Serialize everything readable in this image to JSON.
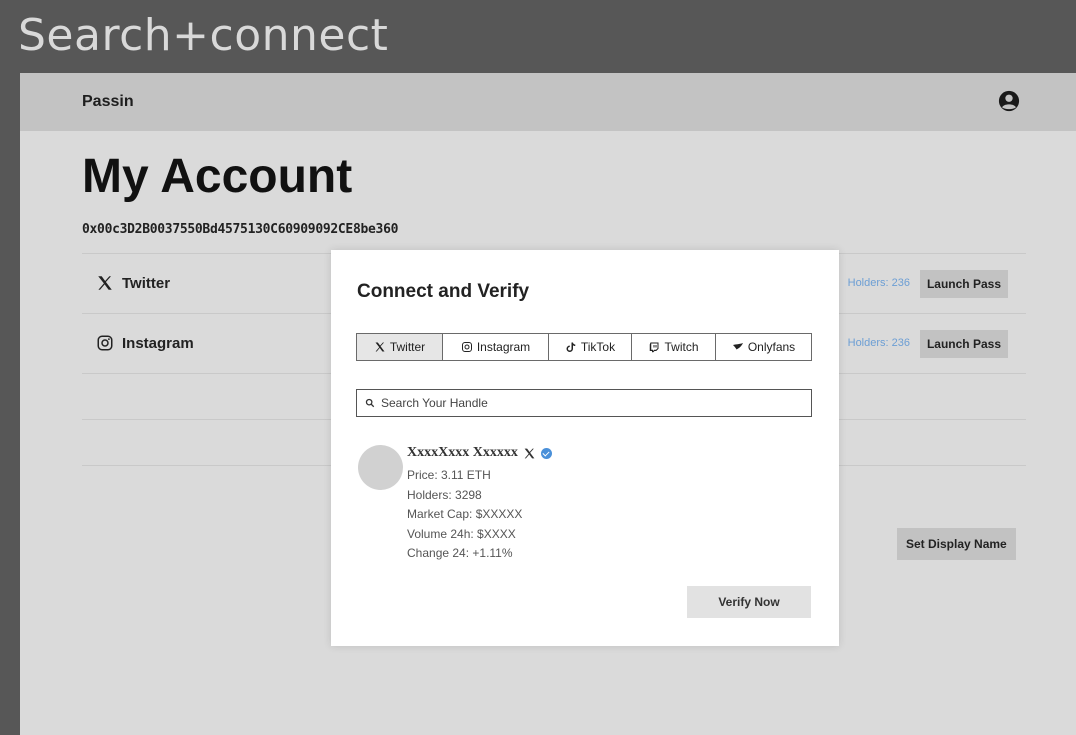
{
  "window": {
    "title": "Search+connect"
  },
  "header": {
    "brand": "Passin",
    "account_icon": "user-circle-icon"
  },
  "page": {
    "title": "My Account",
    "wallet_address": "0x00c3D2B0037550Bd4575130C60909092CE8be360"
  },
  "accounts": [
    {
      "label": "Twitter",
      "icon": "x-logo-icon",
      "link": "Holders: 236",
      "button": "Launch Pass"
    },
    {
      "label": "Instagram",
      "icon": "instagram-icon",
      "link": "Holders: 236",
      "button": "Launch Pass"
    }
  ],
  "display_name_button": "Set Display Name",
  "modal": {
    "title": "Connect and Verify",
    "tabs": [
      {
        "label": "Twitter",
        "icon": "x-logo-icon",
        "active": true
      },
      {
        "label": "Instagram",
        "icon": "instagram-icon",
        "active": false
      },
      {
        "label": "TikTok",
        "icon": "tiktok-icon",
        "active": false
      },
      {
        "label": "Twitch",
        "icon": "twitch-icon",
        "active": false
      },
      {
        "label": "Onlyfans",
        "icon": "onlyfans-icon",
        "active": false
      }
    ],
    "search_placeholder": "Search Your Handle",
    "result": {
      "name": "XxxxXxxx Xxxxxx",
      "price": "Price: 3.11 ETH",
      "holders": "Holders: 3298",
      "market_cap": "Market Cap: $XXXXX",
      "volume": "Volume 24h: $XXXX",
      "change": "Change 24: +1.11%"
    },
    "verify_button": "Verify Now"
  },
  "colors": {
    "accent_link": "#6c9ed4",
    "verified_badge": "#4a90d9"
  }
}
